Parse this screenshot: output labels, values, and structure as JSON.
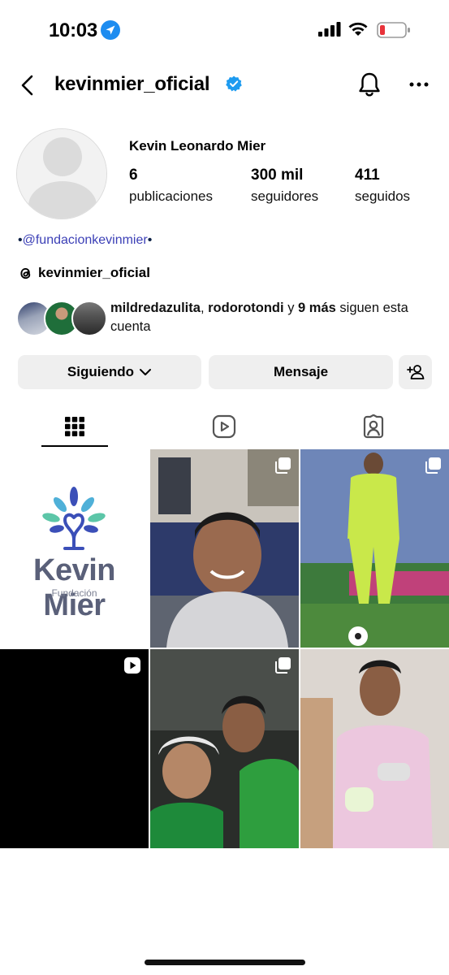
{
  "status_bar": {
    "time": "10:03",
    "icons": [
      "location-icon",
      "signal-icon",
      "wifi-icon",
      "battery-low-icon"
    ],
    "battery_color": "#e8333a"
  },
  "header": {
    "username": "kevinmier_oficial",
    "verified": true,
    "verified_color": "#1d9bf0"
  },
  "profile": {
    "full_name": "Kevin Leonardo Mier",
    "stats": {
      "posts": {
        "value": "6",
        "label": "publicaciones"
      },
      "followers": {
        "value": "300 mil",
        "label": "seguidores"
      },
      "following": {
        "value": "411",
        "label": "seguidos"
      }
    },
    "bio": {
      "prefix": "•",
      "handle": "@fundacionkevinmier",
      "suffix": "•"
    },
    "threads_username": "kevinmier_oficial",
    "mutual": {
      "user1": "mildredazulita",
      "sep": ", ",
      "user2": "rodorotondi",
      "and": " y ",
      "more": "9 más",
      "tail": " siguen esta cuenta"
    }
  },
  "actions": {
    "following": "Siguiendo",
    "message": "Mensaje"
  },
  "tabs": [
    {
      "name": "posts",
      "icon": "grid-icon",
      "active": true
    },
    {
      "name": "reels",
      "icon": "reels-icon",
      "active": false
    },
    {
      "name": "tagged",
      "icon": "tagged-icon",
      "active": false
    }
  ],
  "grid": {
    "tile1": {
      "brand": "Kevin Mier",
      "subtitle": "Fundación",
      "logo_colors": [
        "#3b4fb8",
        "#4fb0d8",
        "#5cc6a8"
      ]
    },
    "tile2": {
      "description": "selfie",
      "badge": "carousel-icon"
    },
    "tile3": {
      "description": "goalkeeper",
      "badge": "carousel-icon"
    },
    "tile4": {
      "badge": "reel-icon"
    },
    "tile5": {
      "badge": "carousel-icon"
    },
    "tile6": {
      "badge": ""
    }
  }
}
